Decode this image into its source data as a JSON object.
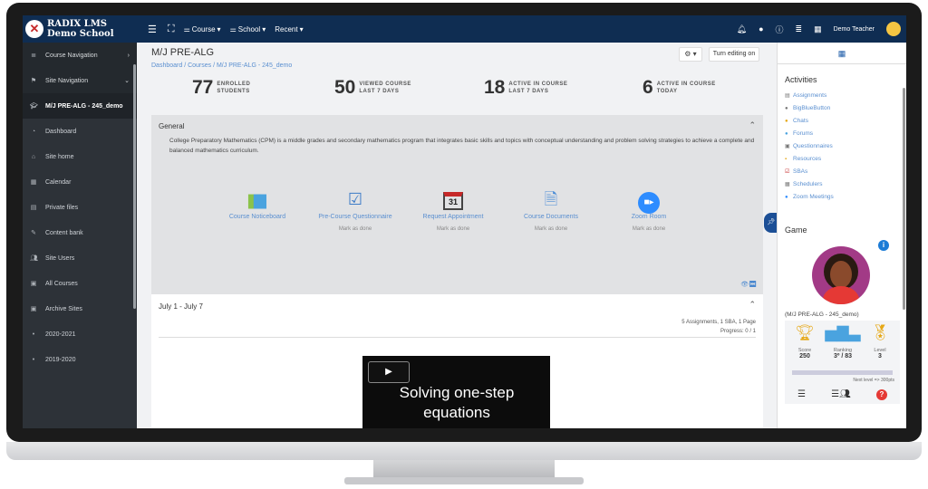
{
  "topbar": {
    "logo_line1": "RADIX LMS",
    "logo_line2": "Demo School",
    "menus": [
      "Course",
      "School",
      "Recent"
    ],
    "user_name": "Demo Teacher"
  },
  "sidebar": {
    "items": [
      {
        "label": "Course Navigation",
        "icon": "list-icon",
        "type": "hdr",
        "chev": "›"
      },
      {
        "label": "Site Navigation",
        "icon": "map-signs-icon",
        "type": "hdr",
        "chev": "⌄"
      },
      {
        "label": "M/J PRE-ALG - 245_demo",
        "icon": "graduation-cap-icon",
        "type": "active"
      },
      {
        "label": "Dashboard",
        "icon": "dashboard-icon"
      },
      {
        "label": "Site home",
        "icon": "home-icon"
      },
      {
        "label": "Calendar",
        "icon": "calendar-icon"
      },
      {
        "label": "Private files",
        "icon": "file-icon"
      },
      {
        "label": "Content bank",
        "icon": "paint-brush-icon"
      },
      {
        "label": "Site Users",
        "icon": "users-icon"
      },
      {
        "label": "All Courses",
        "icon": "archive-icon"
      },
      {
        "label": "Archive Sites",
        "icon": "archive-icon"
      },
      {
        "label": "2020-2021",
        "icon": "bullet-icon"
      },
      {
        "label": "2019-2020",
        "icon": "bullet-icon"
      }
    ]
  },
  "main": {
    "title": "M/J PRE-ALG",
    "breadcrumb": "Dashboard  /  Courses  /  M/J PRE-ALG - 245_demo",
    "edit_button": "Turn editing on",
    "stats": [
      {
        "num": "77",
        "l1": "ENROLLED",
        "l2": "STUDENTS"
      },
      {
        "num": "50",
        "l1": "VIEWED COURSE",
        "l2": "LAST 7 DAYS"
      },
      {
        "num": "18",
        "l1": "ACTIVE IN COURSE",
        "l2": "LAST 7 DAYS"
      },
      {
        "num": "6",
        "l1": "ACTIVE IN COURSE",
        "l2": "TODAY"
      }
    ],
    "general": {
      "title": "General",
      "description": "College Preparatory Mathematics (CPM) is a middle grades and secondary mathematics program that integrates basic skills and topics with conceptual understanding and problem solving strategies to achieve a complete and balanced mathematics curriculum.",
      "activities": [
        {
          "label": "Course Noticeboard",
          "icon": "chat-bubbles-icon",
          "mark": ""
        },
        {
          "label": "Pre-Course Questionnaire",
          "icon": "checklist-icon",
          "mark": "Mark as done"
        },
        {
          "label": "Request Appointment",
          "icon": "calendar-31-icon",
          "mark": "Mark as done"
        },
        {
          "label": "Course Documents",
          "icon": "document-icon",
          "mark": "Mark as done"
        },
        {
          "label": "Zoom Room",
          "icon": "video-camera-icon",
          "mark": "Mark as done"
        }
      ]
    },
    "week": {
      "title": "July 1 - July 7",
      "summary": "5 Assignments, 1 SBA, 1 Page",
      "progress": "Progress: 0 / 1",
      "video_title": "Solving one-step equations"
    }
  },
  "right": {
    "activities_title": "Activities",
    "activities": [
      "Assignments",
      "BigBlueButton",
      "Chats",
      "Forums",
      "Questionnaires",
      "Resources",
      "SBAs",
      "Schedulers",
      "Zoom Meetings"
    ],
    "game_title": "Game",
    "game_course": "(M/J PRE-ALG - 245_demo)",
    "score_label": "Score",
    "score": "250",
    "ranking_label": "Ranking",
    "ranking": "3º / 83",
    "level_label": "Level",
    "level": "3",
    "next_level": "Next level => 300pts"
  }
}
